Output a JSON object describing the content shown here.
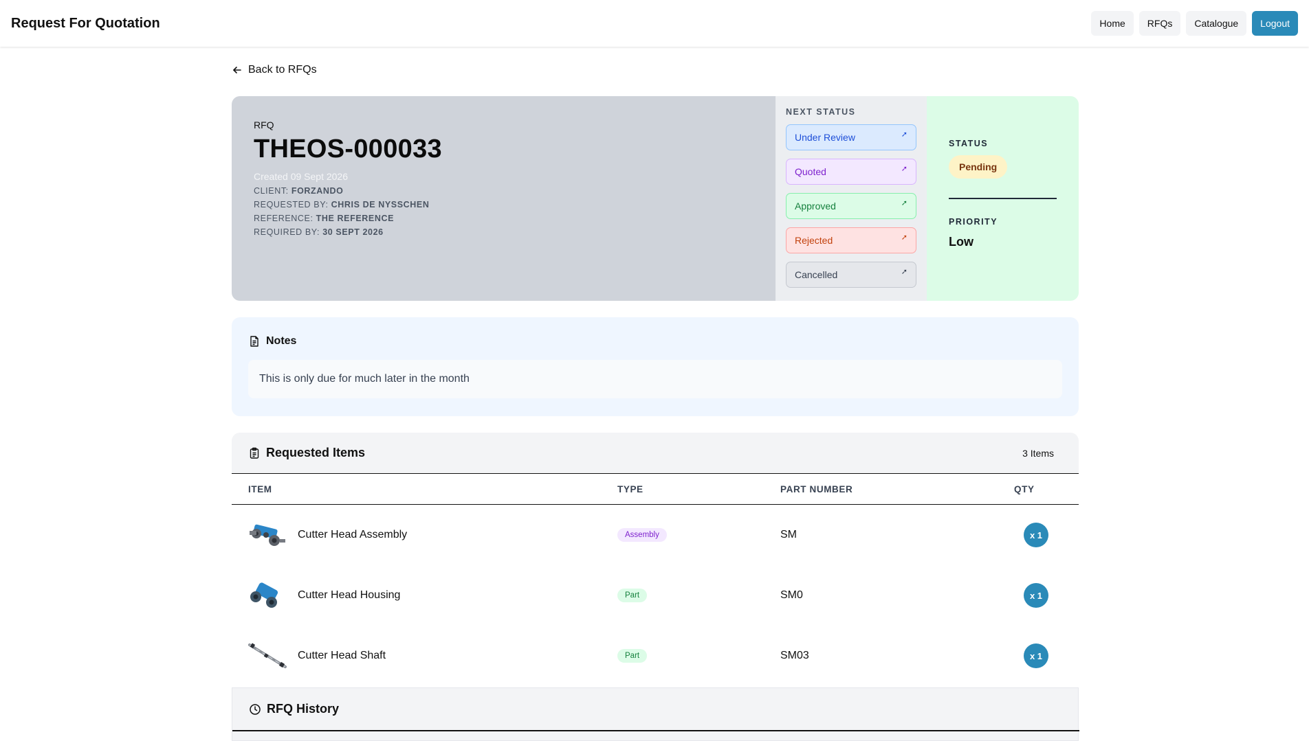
{
  "app": {
    "title": "Request For Quotation",
    "nav": [
      {
        "label": "Home"
      },
      {
        "label": "RFQs"
      },
      {
        "label": "Catalogue"
      },
      {
        "label": "Logout"
      }
    ]
  },
  "back_link": {
    "label": "Back to RFQs"
  },
  "rfq": {
    "label": "RFQ",
    "id": "THEOS-000033",
    "created": "Created 09 Sept 2026",
    "meta": [
      {
        "key": "CLIENT:",
        "value": "FORZANDO"
      },
      {
        "key": "REQUESTED BY:",
        "value": "CHRIS DE NYSSCHEN"
      },
      {
        "key": "REFERENCE:",
        "value": "THE REFERENCE"
      },
      {
        "key": "REQUIRED BY:",
        "value": "30 SEPT 2026"
      }
    ]
  },
  "next_status": {
    "title": "NEXT STATUS",
    "options": [
      {
        "label": "Under Review"
      },
      {
        "label": "Quoted"
      },
      {
        "label": "Approved"
      },
      {
        "label": "Rejected"
      },
      {
        "label": "Cancelled"
      }
    ],
    "arrow_icon": "arrow-up-right-icon"
  },
  "status": {
    "title": "STATUS",
    "value": "Pending",
    "priority_title": "PRIORITY",
    "priority_value": "Low"
  },
  "notes": {
    "title": "Notes",
    "icon": "document-icon",
    "text": "This is only due for much later in the month"
  },
  "items": {
    "title": "Requested Items",
    "icon": "clipboard-icon",
    "count": "3 Items",
    "columns": [
      "ITEM",
      "TYPE",
      "PART NUMBER",
      "QTY"
    ],
    "rows": [
      {
        "name": "Cutter Head Assembly",
        "type": "Assembly",
        "part_number": "SM",
        "qty": "x 1"
      },
      {
        "name": "Cutter Head Housing",
        "type": "Part",
        "part_number": "SM0",
        "qty": "x 1"
      },
      {
        "name": "Cutter Head Shaft",
        "type": "Part",
        "part_number": "SM03",
        "qty": "x 1"
      }
    ]
  },
  "history": {
    "title": "RFQ History",
    "icon": "clock-icon"
  },
  "colors": {
    "accent": "#2a8ab8",
    "header_bg": "#cfd3da",
    "status_bg": "#dcfce7",
    "notes_bg": "#eff6ff",
    "pending_bg": "#fef3c7"
  }
}
